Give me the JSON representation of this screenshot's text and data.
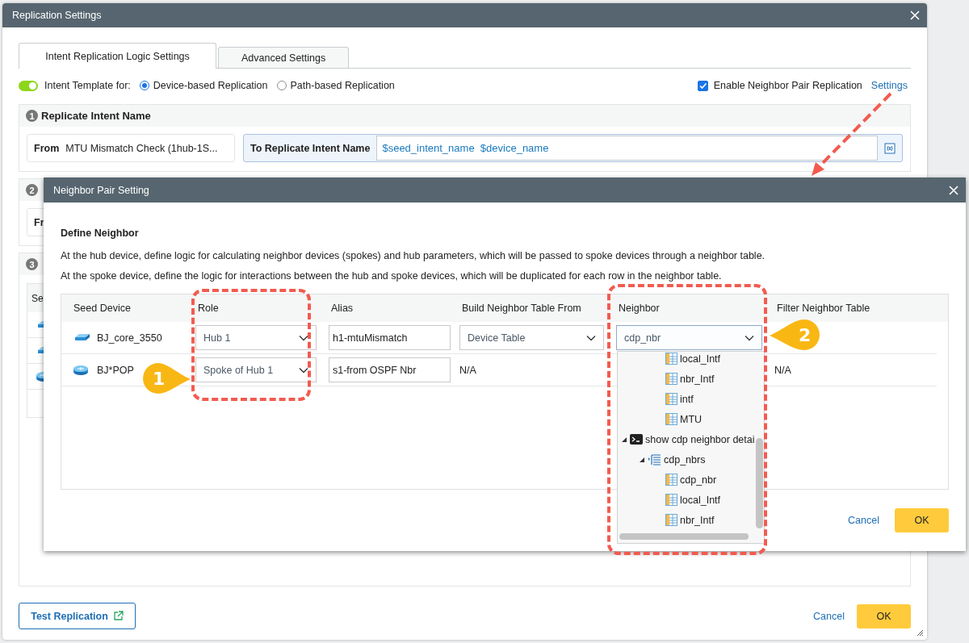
{
  "window": {
    "title": "Replication Settings"
  },
  "tabs": [
    {
      "label": "Intent Replication Logic Settings",
      "selected": true
    },
    {
      "label": "Advanced Settings",
      "selected": false
    }
  ],
  "template": {
    "toggle_on": true,
    "label": "Intent Template for:",
    "options": [
      {
        "label": "Device-based Replication",
        "selected": true
      },
      {
        "label": "Path-based Replication",
        "selected": false
      }
    ]
  },
  "neighbor_pair": {
    "label": "Enable Neighbor Pair Replication",
    "checked": true,
    "link": "Settings"
  },
  "section_1": {
    "number": "1",
    "title": "Replicate Intent Name",
    "from_label": "From",
    "from_value": "MTU Mismatch Check (1hub-1S...",
    "to_label": "To Replicate Intent Name",
    "to_value": "$seed_intent_name  $device_name"
  },
  "section_2": {
    "number": "2",
    "from_label": "Fr"
  },
  "section_3": {
    "number": "3",
    "column_1": "Se",
    "rows": [
      {
        "kind": "switch"
      },
      {
        "kind": "switch"
      },
      {
        "kind": "router"
      }
    ]
  },
  "footer": {
    "test_button": "Test Replication",
    "cancel": "Cancel",
    "ok": "OK"
  },
  "dialog": {
    "title": "Neighbor Pair Setting",
    "heading": "Define Neighbor",
    "paragraphs": [
      "At the hub device, define logic for calculating neighbor devices (spokes) and hub parameters, which will be passed to spoke devices through a neighbor table.",
      "At the spoke device, define the logic for interactions between the hub and spoke devices, which will be duplicated for each row in the neighbor table."
    ],
    "columns": [
      "Seed Device",
      "Role",
      "Alias",
      "Build Neighbor Table From",
      "Neighbor",
      "Filter Neighbor Table"
    ],
    "rows": [
      {
        "device": "BJ_core_3550",
        "kind": "switch",
        "role": "Hub 1",
        "alias": "h1-mtuMismatch",
        "build_from": {
          "kind": "select",
          "value": "Device Table"
        },
        "neighbor": {
          "kind": "select",
          "value": "cdp_nbr",
          "expanded": true
        }
      },
      {
        "device": "BJ*POP",
        "kind": "router",
        "role": "Spoke of Hub 1",
        "alias": "s1-from OSPF Nbr",
        "build_from": {
          "kind": "text",
          "value": "N/A"
        },
        "filter": {
          "kind": "text",
          "value": "N/A"
        }
      }
    ],
    "tree": [
      {
        "children": [
          {
            "children": [
              {
                "label": "local_Intf",
                "kind": "field"
              },
              {
                "label": "nbr_Intf",
                "kind": "field"
              },
              {
                "label": "intf",
                "kind": "field"
              },
              {
                "label": "MTU",
                "kind": "field"
              }
            ]
          }
        ]
      },
      {
        "label": "show cdp neighbor detai",
        "kind": "command",
        "expanded": true,
        "children": [
          {
            "label": "cdp_nbrs",
            "kind": "table",
            "expanded": true,
            "children": [
              {
                "label": "cdp_nbr",
                "kind": "field"
              },
              {
                "label": "local_Intf",
                "kind": "field"
              },
              {
                "label": "nbr_Intf",
                "kind": "field"
              }
            ]
          }
        ]
      }
    ],
    "cancel": "Cancel",
    "ok": "OK"
  },
  "callouts": [
    {
      "label": "1"
    },
    {
      "label": "2"
    }
  ]
}
